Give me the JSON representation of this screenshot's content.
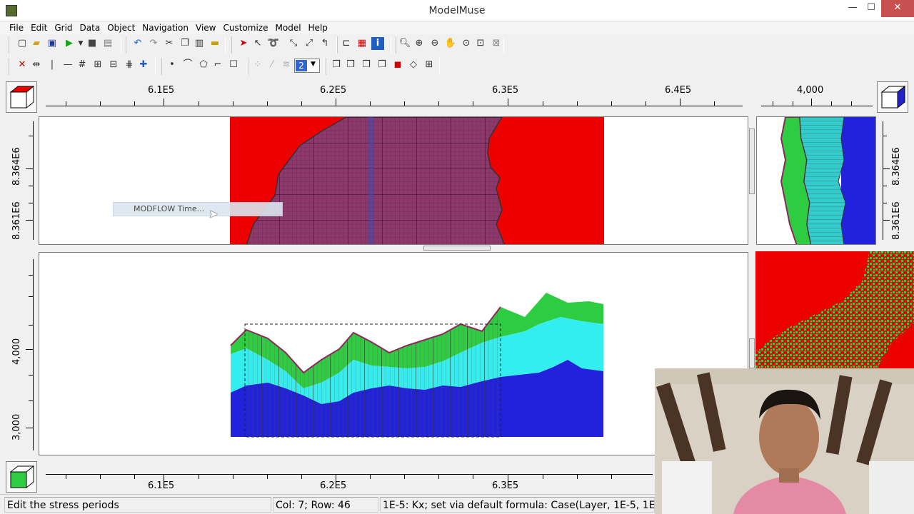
{
  "window": {
    "title": "ModelMuse",
    "minimize": "—",
    "maximize": "☐",
    "close": "✕"
  },
  "menu": [
    "File",
    "Edit",
    "Grid",
    "Data",
    "Object",
    "Navigation",
    "View",
    "Customize",
    "Model",
    "Help"
  ],
  "toolbar": {
    "layer_selector_value": "2"
  },
  "top_view": {
    "x_ticks": [
      "6.1E5",
      "6.2E5",
      "6.3E5",
      "6.4E5"
    ],
    "y_ticks": [
      "8.364E6",
      "8.361E6"
    ]
  },
  "side_view": {
    "x_ticks": [
      "4,000"
    ],
    "y_ticks": [
      "8.364E6",
      "8.361E6"
    ]
  },
  "front_view": {
    "x_ticks": [
      "6.1E5",
      "6.2E5",
      "6.3E5"
    ],
    "y_ticks": [
      "4,000",
      "3,000"
    ]
  },
  "popup_menu": {
    "item": "MODFLOW Time..."
  },
  "status": {
    "hint": "Edit the stress periods",
    "position": "Col: 7; Row: 46",
    "formula": "1E-5: Kx; set via default formula: Case(Layer, 1E-5, 1E-5, 1"
  },
  "colors": {
    "red": "#ee0000",
    "green": "#2ecc40",
    "cyan": "#33cccc",
    "blue": "#2222dd",
    "grid": "#7a3a7a"
  }
}
